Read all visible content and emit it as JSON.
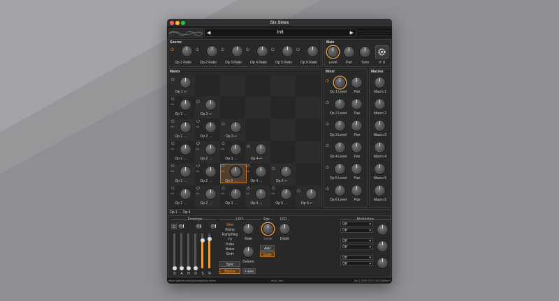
{
  "window": {
    "title": "Six Sines"
  },
  "colors": {
    "accent": "#e89a3c",
    "background": "#8e8e93",
    "panel": "#282828"
  },
  "preset": {
    "name": "Init",
    "prev": "◀",
    "next": "▶"
  },
  "source": {
    "title": "Source",
    "knobs": [
      "Op 1 Ratio",
      "Op 2 Ratio",
      "Op 3 Ratio",
      "Op 4 Ratio",
      "Op 5 Ratio",
      "Op 6 Ratio"
    ]
  },
  "main": {
    "title": "Main",
    "level": "Level",
    "pan": "Pan",
    "tune": "Tune",
    "version": "V: 0",
    "settings_icon": "gear-icon"
  },
  "matrix": {
    "title": "Matrix",
    "feedback": [
      "Op 1 ↩",
      "Op 2 ↩",
      "Op 3 ↩",
      "Op 4 ↩",
      "Op 5 ↩",
      "Op 6 ↩"
    ],
    "rows": [
      [
        "Op 1 →"
      ],
      [
        "Op 1 →",
        "Op 2 →"
      ],
      [
        "Op 1 →",
        "Op 2 →",
        "Op 3 →"
      ],
      [
        "Op 1 →",
        "Op 2 →",
        "Op 3 →",
        "Op 4 →"
      ],
      [
        "Op 1 →",
        "Op 2 →",
        "Op 3 →",
        "Op 4 →",
        "Op 5 →"
      ]
    ],
    "mod_symbol": "≈A"
  },
  "mixer": {
    "title": "Mixer",
    "levels": [
      "Op 1 Level",
      "Op 2 Level",
      "Op 3 Level",
      "Op 4 Level",
      "Op 5 Level",
      "Op 6 Level"
    ],
    "pan": "Pan"
  },
  "macros": {
    "title": "Macros",
    "items": [
      "Macro 1",
      "Macro 2",
      "Macro 3",
      "Macro 4",
      "Macro 5",
      "Macro 6"
    ]
  },
  "edit": {
    "selected": "Op 1 → Op 4",
    "envelope": {
      "title": "Envelope",
      "sliders": [
        "D",
        "A",
        "H",
        "D",
        "S",
        "R"
      ]
    },
    "lfo": {
      "title": "LFO",
      "waves": [
        "Sine",
        "Ramp",
        "RampNeg",
        "Tri",
        "Pulse",
        "Noise",
        "SmH"
      ],
      "sync": "Sync",
      "bipolar": "Bipolar",
      "rate": "Rate",
      "deform": "Deform",
      "env_btn": "+ Env"
    },
    "env_mod": {
      "title": "Env→",
      "level": "Level"
    },
    "lfo_mod": {
      "title": "LFO→",
      "depth": "Depth"
    },
    "add_scale": {
      "add": "Add",
      "scale": "Scale"
    },
    "modulation": {
      "title": "Modulation",
      "off": "Off"
    }
  },
  "status": {
    "url": "https://github.com/baconpaul/six-sines",
    "build": "local--dev",
    "date": "Jan 1 2025 07:57:44 2a54bd7"
  }
}
